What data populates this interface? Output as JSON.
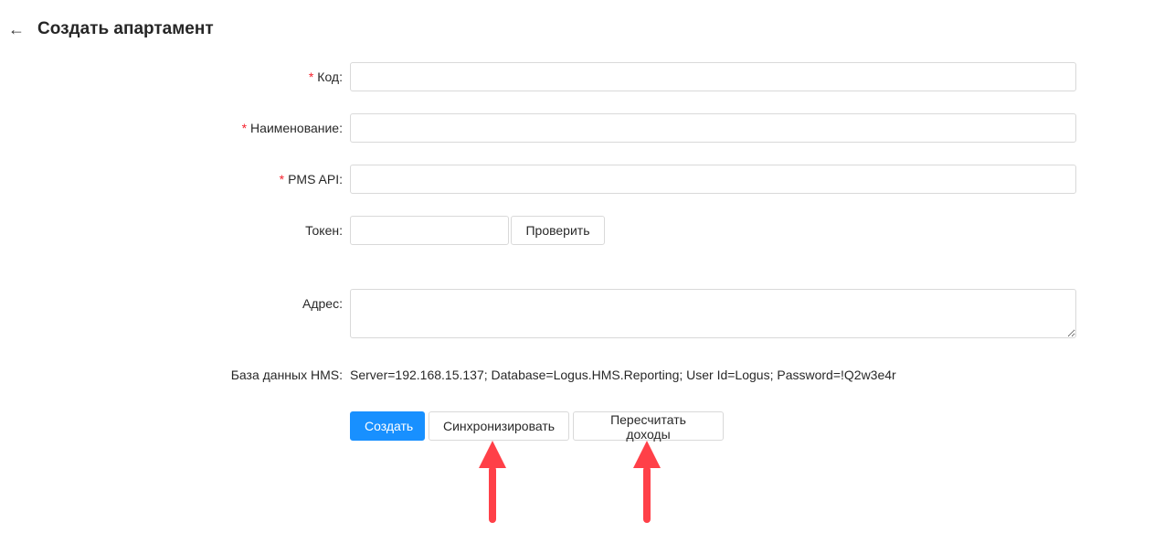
{
  "header": {
    "back_icon": "arrow-left-icon",
    "back_glyph": "←",
    "title": "Создать апартамент"
  },
  "form": {
    "required_mark": "*",
    "code": {
      "label": "Код",
      "value": ""
    },
    "name": {
      "label": "Наименование",
      "value": ""
    },
    "pms_api": {
      "label": "PMS API",
      "value": ""
    },
    "token": {
      "label": "Токен",
      "value": "",
      "check_button": "Проверить"
    },
    "address": {
      "label": "Адрес",
      "value": ""
    },
    "hms_db": {
      "label": "База данных HMS",
      "value": "Server=192.168.15.137; Database=Logus.HMS.Reporting; User Id=Logus; Password=!Q2w3e4r"
    },
    "colon": ":"
  },
  "actions": {
    "create": "Создать",
    "sync": "Синхронизировать",
    "recalc": "Пересчитать доходы"
  },
  "colors": {
    "primary": "#1890ff",
    "required": "#f5222d",
    "arrow": "#ff4048"
  }
}
